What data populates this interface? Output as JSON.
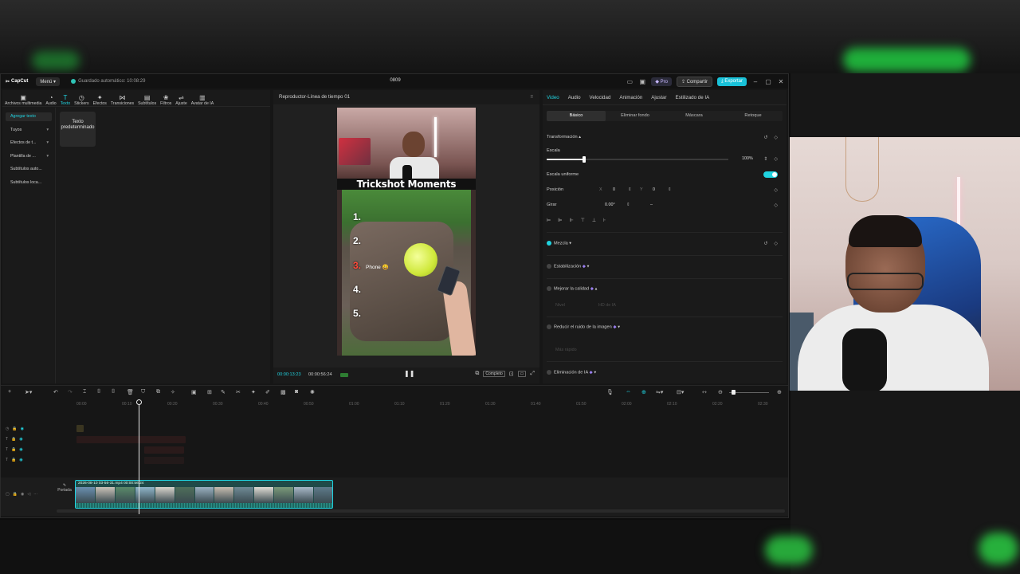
{
  "app": {
    "logo": "CapCut",
    "menu": "Menú",
    "autosave": "Guardado automático: 10:08:29",
    "project_title": "0809",
    "pro": "Pro",
    "share": "Compartir",
    "export": "Exportar"
  },
  "toolbar": [
    {
      "icon": "media-icon",
      "label": "Archivos multimedia"
    },
    {
      "icon": "audio-icon",
      "label": "Audio"
    },
    {
      "icon": "text-icon",
      "label": "Texto",
      "active": true
    },
    {
      "icon": "stickers-icon",
      "label": "Stickers"
    },
    {
      "icon": "effects-icon",
      "label": "Efectos"
    },
    {
      "icon": "transitions-icon",
      "label": "Transiciones"
    },
    {
      "icon": "subtitles-icon",
      "label": "Subtítulos"
    },
    {
      "icon": "filters-icon",
      "label": "Filtros"
    },
    {
      "icon": "adjust-icon",
      "label": "Ajuste"
    },
    {
      "icon": "avatar-icon",
      "label": "Avatar de IA"
    }
  ],
  "sidenav": [
    {
      "label": "Agregar texto",
      "active": true,
      "chev": false
    },
    {
      "label": "Tuyos",
      "chev": true
    },
    {
      "label": "Efectos de t...",
      "chev": true
    },
    {
      "label": "Plantilla de ...",
      "chev": true
    },
    {
      "label": "Subtítulos auto...",
      "chev": false
    },
    {
      "label": "Subtítulos loca...",
      "chev": false
    }
  ],
  "text_card": "Texto predeterminado",
  "player": {
    "title": "Reproductor-Línea de tiempo 01",
    "time_current": "00:00:13:23",
    "time_total": "00:00:56:24",
    "ratio_label": "Completo"
  },
  "video_overlay": {
    "banner": "Trickshot Moments",
    "n1": "1.",
    "n2": "2.",
    "n3": "3.",
    "n4": "4.",
    "n5": "5.",
    "phone": "Phone 😀"
  },
  "right_panel": {
    "tabs": [
      "Video",
      "Audio",
      "Velocidad",
      "Animación",
      "Ajustar",
      "Estilizado de IA"
    ],
    "subtabs": [
      "Básico",
      "Eliminar fondo",
      "Máscara",
      "Retoque"
    ],
    "transform": "Transformación",
    "scale": "Escala",
    "scale_value": "100%",
    "uniform_scale": "Escala uniforme",
    "position": "Posición",
    "x_label": "X",
    "x_value": "0",
    "y_label": "Y",
    "y_value": "0",
    "rotate": "Girar",
    "rotate_value": "0.00°",
    "blend": "Mezcla",
    "stabilization": "Estabilización",
    "enhance": "Mejorar la calidad",
    "enhance_level": "Nivel",
    "enhance_option": "HD de IA",
    "denoise": "Reducir el ruido de la imagen",
    "denoise_option": "Más rápido",
    "removal": "Eliminación de IA"
  },
  "timeline": {
    "ticks": [
      "00:00",
      "00:10",
      "00:20",
      "00:30",
      "00:40",
      "00:50",
      "01:00",
      "01:10",
      "01:20",
      "01:30",
      "01:40",
      "01:50",
      "02:00",
      "02:10",
      "02:20",
      "02:30"
    ],
    "clip_label": "2026-08-10 03-56-31.mp4 00:00:56:24",
    "cover_label": "Portada"
  },
  "colors": {
    "accent": "#20d3e0",
    "export": "#19c1d8"
  }
}
